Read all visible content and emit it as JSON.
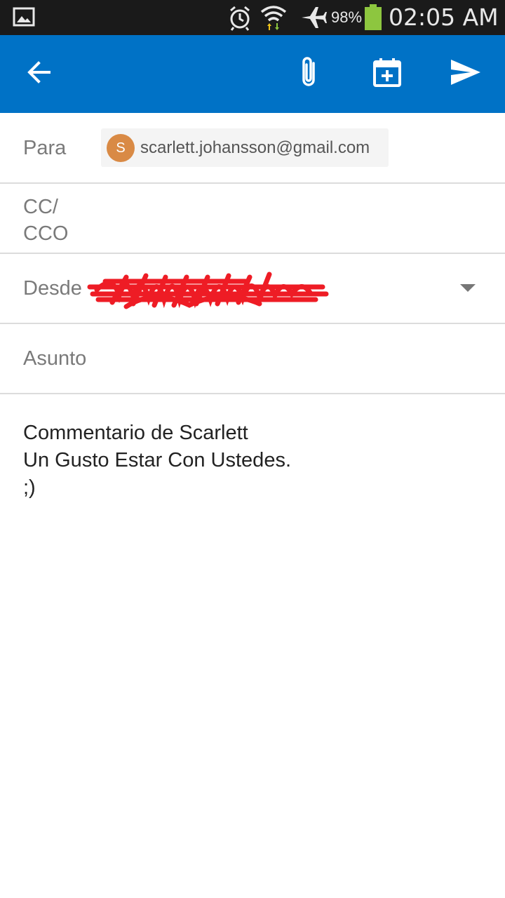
{
  "status_bar": {
    "battery_percent": "98%",
    "time": "02:05 AM",
    "icons": [
      "gallery-icon",
      "alarm-icon",
      "wifi-icon",
      "airplane-icon",
      "battery-icon"
    ],
    "battery_color": "#8dc63f"
  },
  "toolbar": {
    "background": "#0072c6",
    "icons": [
      "back-arrow-icon",
      "paperclip-icon",
      "calendar-add-icon",
      "send-icon"
    ]
  },
  "compose": {
    "to_label": "Para",
    "to_recipient": {
      "initial": "S",
      "email": "scarlett.johansson@gmail.com",
      "avatar_color": "#d98a45"
    },
    "cc_label": "CC/\nCCO",
    "from_label": "Desde",
    "subject_label": "Asunto",
    "body": "Commentario de Scarlett\nUn Gusto Estar Con Ustedes.\n;)"
  }
}
